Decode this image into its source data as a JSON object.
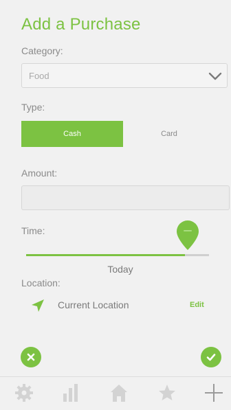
{
  "header": {
    "title": "Add a Purchase"
  },
  "category": {
    "label": "Category:",
    "value": "Food"
  },
  "type": {
    "label": "Type:",
    "options": [
      "Cash",
      "Card"
    ],
    "selected": "Cash"
  },
  "amount": {
    "label": "Amount:",
    "value": ""
  },
  "time": {
    "label": "Time:",
    "value": "Today",
    "slider_fraction": 0.87
  },
  "location": {
    "label": "Location:",
    "value": "Current Location",
    "edit_label": "Edit"
  },
  "actions": {
    "cancel_icon": "close-icon",
    "confirm_icon": "check-icon"
  },
  "tabbar": {
    "items": [
      "gear-icon",
      "bar-chart-icon",
      "home-icon",
      "star-icon",
      "plus-icon"
    ]
  },
  "colors": {
    "accent": "#7cc242",
    "background": "#f1f1f1",
    "text": "#8a8a8a"
  }
}
